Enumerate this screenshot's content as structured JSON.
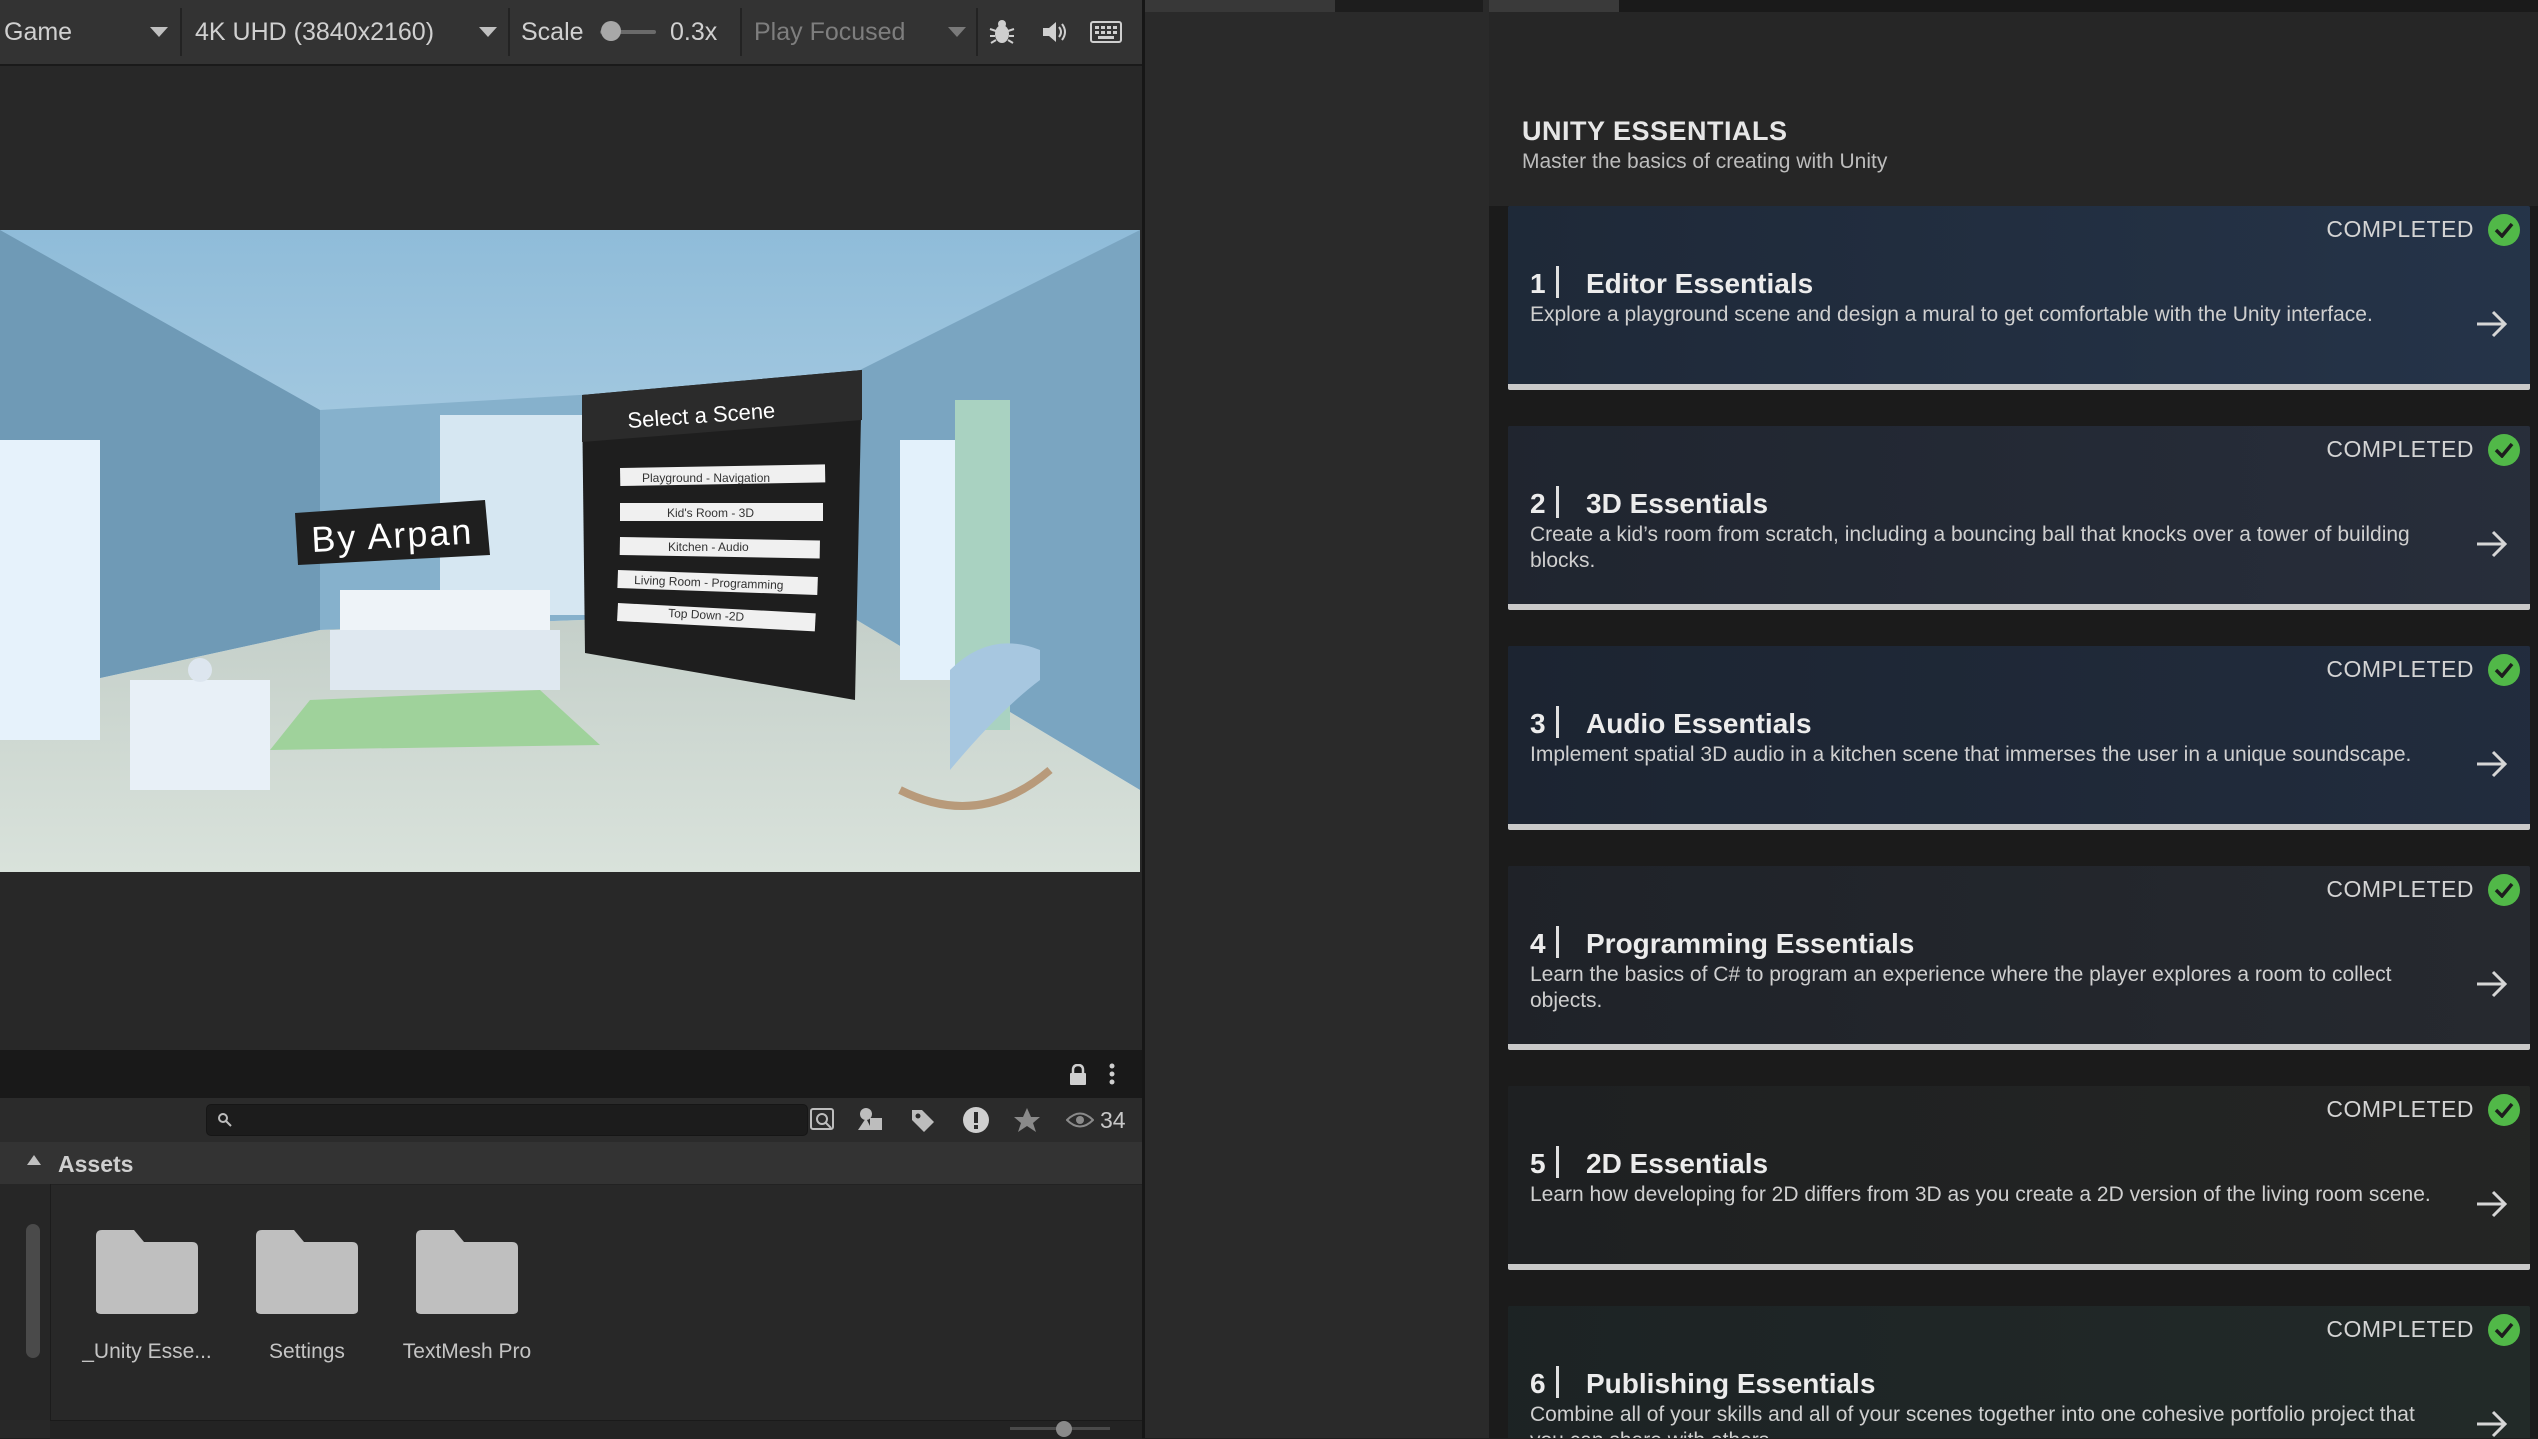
{
  "game_toolbar": {
    "display_label": "Game",
    "resolution_label": "4K UHD (3840x2160)",
    "scale_label": "Scale",
    "scale_value": "0.3x",
    "scale_fraction": 0.05,
    "play_mode_label": "Play Focused"
  },
  "game_scene": {
    "banner_text": "By Arpan",
    "menu_title": "Select a Scene",
    "menu_items": [
      "Playground - Navigation",
      "Kid's Room - 3D",
      "Kitchen - Audio",
      "Living Room - Programming",
      "Top Down -2D"
    ]
  },
  "project": {
    "search_placeholder": "",
    "visibility_count": "34",
    "breadcrumb": "Assets",
    "folders": [
      "_Unity Esse...",
      "Settings",
      "TextMesh Pro"
    ]
  },
  "tutorials": {
    "title": "UNITY ESSENTIALS",
    "subtitle": "Master the basics of creating with Unity",
    "completed_label": "COMPLETED",
    "cards": [
      {
        "number": "1",
        "title": "Editor Essentials",
        "description": "Explore a playground scene and design a mural to get comfortable with the Unity interface.",
        "color": "#2b3d57"
      },
      {
        "number": "2",
        "title": "3D Essentials",
        "description": "Create a kid’s room from scratch, including a bouncing ball that knocks over a tower of building blocks.",
        "color": "#2e3544"
      },
      {
        "number": "3",
        "title": "Audio Essentials",
        "description": "Implement spatial 3D audio in a kitchen scene that immerses the user in a unique soundscape.",
        "color": "#263348"
      },
      {
        "number": "4",
        "title": "Programming Essentials",
        "description": "Learn the basics of C# to program an experience where the player explores a room to collect objects.",
        "color": "#2c2f35"
      },
      {
        "number": "5",
        "title": "2D Essentials",
        "description": "Learn how developing for 2D differs from 3D as you create a 2D version of the living room scene.",
        "color": "#2a2a26"
      },
      {
        "number": "6",
        "title": "Publishing Essentials",
        "description": "Combine all of your skills and all of your scenes together into one cohesive portfolio project that you can share with others.",
        "color": "#27302c"
      }
    ]
  },
  "colors": {
    "check_green": "#51b848",
    "panel_dark": "#1f1f1f",
    "toolbar": "#333333"
  }
}
